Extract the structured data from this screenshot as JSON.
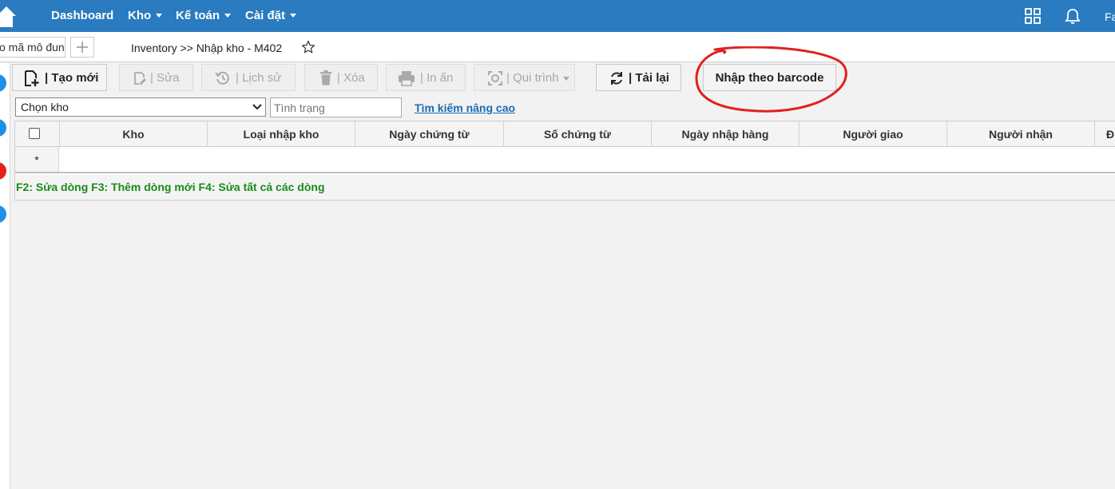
{
  "nav": {
    "items": [
      {
        "label": "Dashboard",
        "caret": false
      },
      {
        "label": "Kho",
        "caret": true
      },
      {
        "label": "Kế toán",
        "caret": true
      },
      {
        "label": "Cài đặt",
        "caret": true
      }
    ],
    "user_initial": "Fa",
    "icons": [
      "home-icon",
      "grid-icon",
      "bell-icon"
    ]
  },
  "subbar": {
    "module_search_value": "o mã mô đun",
    "breadcrumb": "Inventory >> Nhập kho - M402"
  },
  "toolbar": {
    "create": "| Tạo mới",
    "edit": "| Sửa",
    "history": "| Lịch sử",
    "delete": "| Xóa",
    "print": "| In ấn",
    "process": "| Qui trình",
    "reload": "| Tải lại",
    "barcode": "Nhập theo barcode"
  },
  "filters": {
    "warehouse_select": "Chọn kho",
    "status_placeholder": "Tình trạng",
    "advanced_search": "Tìm kiếm nâng cao"
  },
  "table": {
    "columns": [
      "Kho",
      "Loại nhập kho",
      "Ngày chứng từ",
      "Số chứng từ",
      "Ngày nhập hàng",
      "Người giao",
      "Người nhận",
      "Đ"
    ],
    "new_row_marker": "*"
  },
  "hint": "F2: Sửa dòng F3: Thêm dòng mới F4: Sửa tất cả các dòng",
  "colors": {
    "nav_bg": "#2a7bbf",
    "link": "#1a6ab5",
    "hint": "#1a8a1a",
    "annotation": "#e02020"
  }
}
